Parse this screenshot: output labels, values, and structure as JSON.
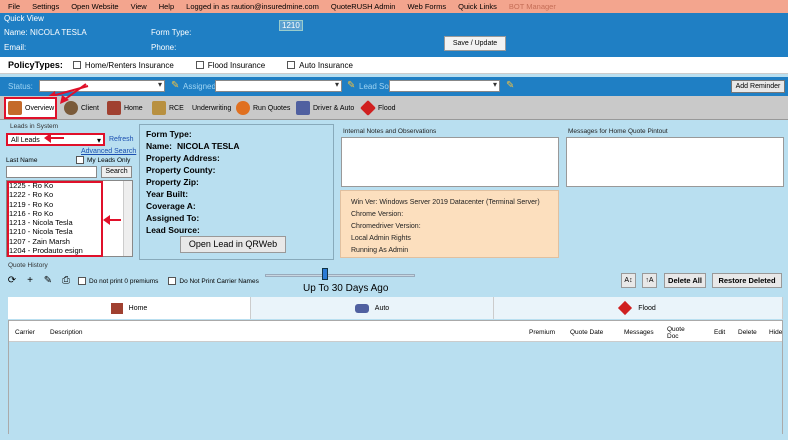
{
  "menu": [
    "File",
    "Settings",
    "Open Website",
    "View",
    "Help",
    "Logged in as raution@insuredmine.com",
    "QuoteRUSH Admin",
    "Web Forms",
    "Quick Links"
  ],
  "menu_dim": "BOT Manager",
  "quick_view": {
    "legend": "Quick View",
    "name_label": "Name:",
    "name_value": "NICOLA TESLA",
    "email_label": "Email:",
    "form_type_label": "Form Type:",
    "phone_label": "Phone:",
    "id_badge": "1210",
    "save_button": "Save / Update"
  },
  "policy": {
    "title": "PolicyTypes:",
    "options": [
      "Home/Renters Insurance",
      "Flood Insurance",
      "Auto Insurance"
    ]
  },
  "status_bar": {
    "status_label": "Status:",
    "assigned_label": "Assigned:",
    "lead_source_label": "Lead Source:",
    "add_reminder": "Add Reminder"
  },
  "tabs": [
    "Overview",
    "Client",
    "Home",
    "RCE",
    "Underwriting",
    "Run Quotes",
    "Driver & Auto",
    "Flood"
  ],
  "leads": {
    "label": "Leads in System",
    "selected": "All Leads",
    "refresh": "Refresh",
    "advanced_search": "Advanced Search",
    "last_name_label": "Last Name",
    "my_leads_only": "My Leads Only",
    "search_button": "Search",
    "items": [
      "1225 - Ro Ko",
      "1222 - Ro Ko",
      "1219 - Ro Ko",
      "1216 - Ro Ko",
      "1213 - Nicola Tesla",
      "1210 - Nicola Tesla",
      "1207 - Zain  Marsh",
      "1204 - Prodauto esign"
    ]
  },
  "info": {
    "form_type": "Form Type:",
    "name_label": "Name:",
    "name_value": "NICOLA TESLA",
    "property_address": "Property Address:",
    "property_county": "Property County:",
    "property_zip": "Property Zip:",
    "year_built": "Year Built:",
    "coverage_a": "Coverage A:",
    "assigned_to": "Assigned To:",
    "lead_source": "Lead Source:",
    "open_button": "Open Lead in QRWeb"
  },
  "notes": {
    "internal_label": "Internal Notes and Observations",
    "messages_label": "Messages for Home Quote Pintout"
  },
  "sysinfo": [
    "Win Ver: Windows Server 2019 Datacenter (Terminal Server)",
    "Chrome Version:",
    "Chromedriver Version:",
    "Local Admin Rights",
    "Running As Admin"
  ],
  "quote_history": {
    "label": "Quote History",
    "opt1": "Do not print 0 premiums",
    "opt2": "Do Not Print Carrier Names",
    "slider_label": "Up To 30 Days Ago",
    "delete_all": "Delete All",
    "restore_deleted": "Restore Deleted"
  },
  "bottom_tabs": [
    "Home",
    "Auto",
    "Flood"
  ],
  "grid_columns": [
    "Carrier",
    "Description",
    "Premium",
    "Quote Date",
    "Messages",
    "Quote Doc",
    "Edit",
    "Delete",
    "Hide"
  ],
  "colors": {
    "menubar": "#f3a58e",
    "header_blue": "#1f7fc4",
    "panel": "#b9dff0",
    "sysinfo": "#fcdfbe",
    "annotation_red": "#e0102a"
  }
}
